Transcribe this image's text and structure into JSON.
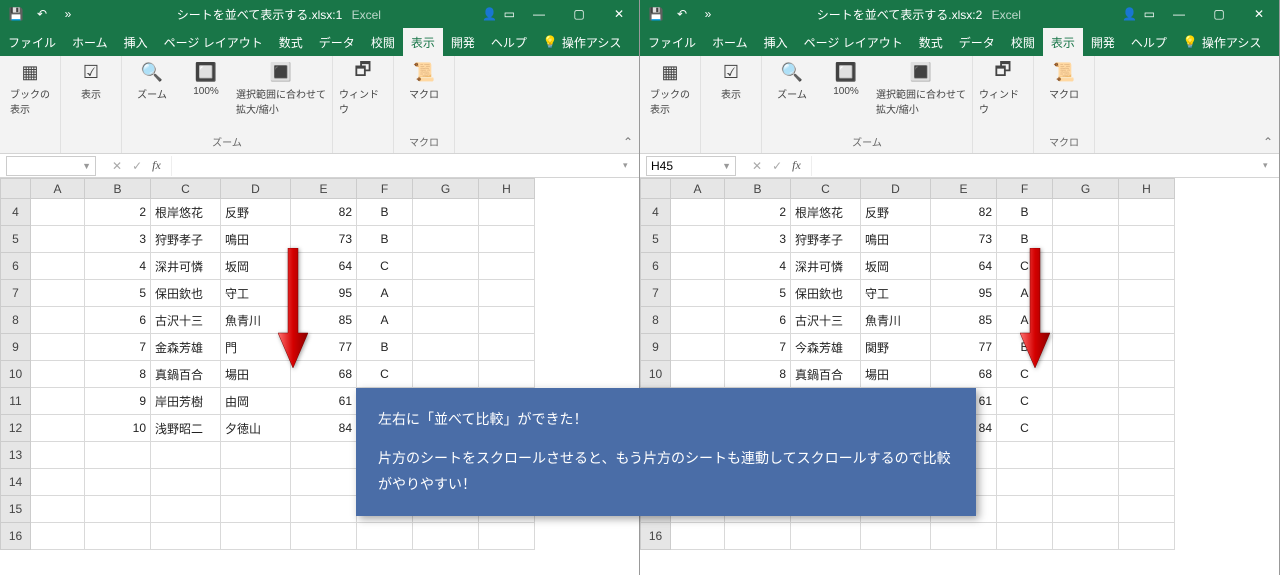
{
  "windows": [
    {
      "title_doc": "シートを並べて表示する.xlsx:1",
      "title_app": "Excel",
      "namebox": ""
    },
    {
      "title_doc": "シートを並べて表示する.xlsx:2",
      "title_app": "Excel",
      "namebox": "H45"
    }
  ],
  "menu": {
    "file": "ファイル",
    "home": "ホーム",
    "insert": "挿入",
    "layout": "ページ レイアウト",
    "formula": "数式",
    "data": "データ",
    "review": "校閲",
    "view": "表示",
    "dev": "開発",
    "help": "ヘルプ",
    "tell": "操作アシス"
  },
  "ribbon": {
    "book_view": "ブックの\n表示",
    "show": "表示",
    "zoom": "ズーム",
    "hundred": "100%",
    "fit_sel": "選択範囲に合わせて\n拡大/縮小",
    "window": "ウィンドウ",
    "macro": "マクロ",
    "grp_zoom": "ズーム",
    "grp_macro": "マクロ"
  },
  "cols_w": [
    30,
    54,
    66,
    70,
    70,
    66,
    56,
    66,
    56
  ],
  "cols": [
    "A",
    "B",
    "C",
    "D",
    "E",
    "F",
    "G",
    "H"
  ],
  "rows": [
    4,
    5,
    6,
    7,
    8,
    9,
    10,
    11,
    12,
    13,
    14,
    15,
    16
  ],
  "chart_data": {
    "type": "table",
    "data": [
      {
        "row": 4,
        "B": 2,
        "C": "根岸悠花",
        "D": "反野",
        "E": 82,
        "F": "B"
      },
      {
        "row": 5,
        "B": 3,
        "C": "狩野孝子",
        "D": "鳴田",
        "E": 73,
        "F": "B"
      },
      {
        "row": 6,
        "B": 4,
        "C": "深井可憐",
        "D": "坂岡",
        "E": 64,
        "F": "C"
      },
      {
        "row": 7,
        "B": 5,
        "C": "保田欽也",
        "D": "守工",
        "E": 95,
        "F": "A"
      },
      {
        "row": 8,
        "B": 6,
        "C": "古沢十三",
        "D": "魚青川",
        "E": 85,
        "F": "A"
      },
      {
        "row": 9,
        "B": 7,
        "C": "金森芳雄",
        "D": "門",
        "E": 77,
        "F": "B"
      },
      {
        "row": 10,
        "B": 8,
        "C": "真鍋百合",
        "D": "場田",
        "E": 68,
        "F": "C"
      },
      {
        "row": 11,
        "B": 9,
        "C": "岸田芳樹",
        "D": "由岡",
        "E": 61,
        "F": "C"
      },
      {
        "row": 12,
        "B": 10,
        "C": "浅野昭二",
        "D": "夕徳山",
        "E": 84,
        "F": "C"
      }
    ]
  },
  "right_override": {
    "9": {
      "C": "今森芳雄",
      "D": "関野"
    }
  },
  "callout": {
    "line1": "左右に「並べて比較」ができた！",
    "line2": "片方のシートをスクロールさせると、もう片方のシートも連動してスクロールするので比較がやりやすい！"
  }
}
